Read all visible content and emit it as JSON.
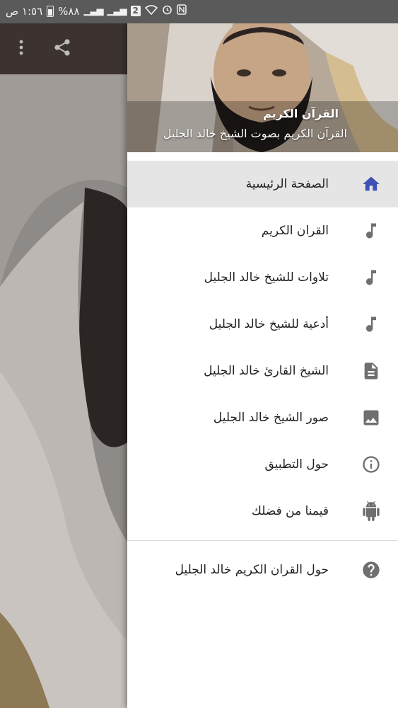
{
  "status_bar": {
    "time": "١:٥٦ ص",
    "battery": "%٨٨",
    "sim_slot": "2"
  },
  "toolbar": {
    "share_icon": "share-icon",
    "more_icon": "more-vert-icon"
  },
  "drawer": {
    "header": {
      "title": "القرآن الكريم",
      "subtitle": "القرآن الكريم بصوت الشيخ خالد الجليل"
    },
    "items": [
      {
        "label": "الصفحة الرئيسية",
        "icon": "home-icon",
        "selected": true
      },
      {
        "label": "القران الكريم",
        "icon": "music-note-icon"
      },
      {
        "label": "تلاوات للشيخ خالد الجليل",
        "icon": "music-note-icon"
      },
      {
        "label": "أدعية للشيخ خالد الجليل",
        "icon": "music-note-icon"
      },
      {
        "label": "الشيخ القارئ خالد الجليل",
        "icon": "document-icon"
      },
      {
        "label": "صور الشيخ خالد الجليل",
        "icon": "image-icon"
      },
      {
        "label": "حول التطبيق",
        "icon": "info-icon"
      },
      {
        "label": "قيمنا من فضلك",
        "icon": "android-icon"
      }
    ],
    "footer_items": [
      {
        "label": "حول القران الكريم خالد الجليل",
        "icon": "help-icon"
      }
    ]
  },
  "colors": {
    "accent": "#3f51b5",
    "icon_grey": "#6f6f6f",
    "selected_bg": "#e5e5e5",
    "toolbar_bg": "#3c3230"
  }
}
